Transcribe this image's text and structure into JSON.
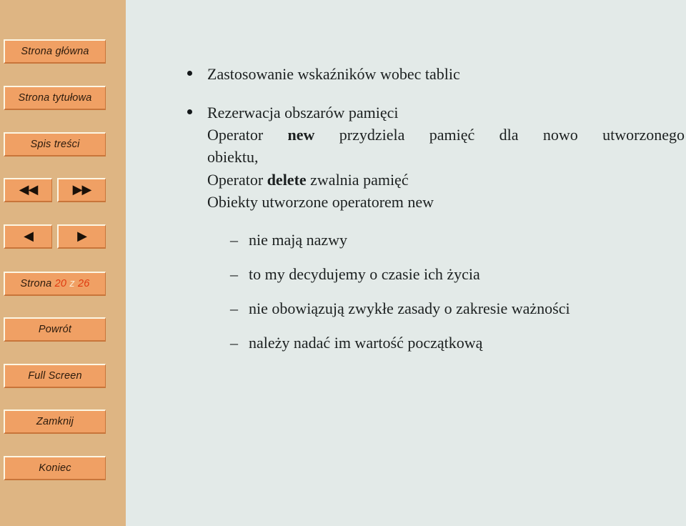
{
  "sidebar": {
    "buttons": [
      {
        "label": "Strona główna",
        "name": "home-button"
      },
      {
        "label": "Strona tytułowa",
        "name": "title-page-button"
      },
      {
        "label": "Spis treści",
        "name": "table-of-contents-button"
      }
    ],
    "nav_arrows": [
      {
        "glyph": "◀◀",
        "name": "first-slide-button"
      },
      {
        "glyph": "▶▶",
        "name": "last-slide-button"
      },
      {
        "glyph": "◀",
        "name": "previous-slide-button"
      },
      {
        "glyph": "▶",
        "name": "next-slide-button"
      }
    ],
    "page_indicator": {
      "label": "Strona",
      "current": "20",
      "separator": "z",
      "total": "26"
    },
    "back_label": "Powrót",
    "fullscreen_label": "Full Screen",
    "close_label": "Zamknij",
    "end_label": "Koniec",
    "colors": {
      "background": "#deb583",
      "button_fill": "#f0a064",
      "button_highlight": "#fdf6e3",
      "button_shadow": "#c8753a",
      "text": "#2b1a0c",
      "page_number": "#e03a10"
    }
  },
  "content": {
    "background": "#e3eae8",
    "text_color": "#1c2020",
    "bullet1": "Zastosowanie wskaźników wobec tablic",
    "bullet2": "Rezerwacja obszarów pamięci",
    "line_new_pre": "Operator ",
    "line_new_kw": "new",
    "line_new_post": " przydziela pamięć dla nowo utworzonego",
    "line_obiektu": "obiektu,",
    "line_delete_pre": "Operator ",
    "line_delete_kw": "delete",
    "line_delete_post": " zwalnia pamięć",
    "line_objects": "Obiekty utworzone operatorem new",
    "dash_items": [
      "nie mają nazwy",
      "to my decydujemy o czasie ich życia",
      "nie obowiązują zwykłe zasady o zakresie ważności",
      "należy nadać im wartość początkową"
    ],
    "dash_glyph": "–"
  }
}
